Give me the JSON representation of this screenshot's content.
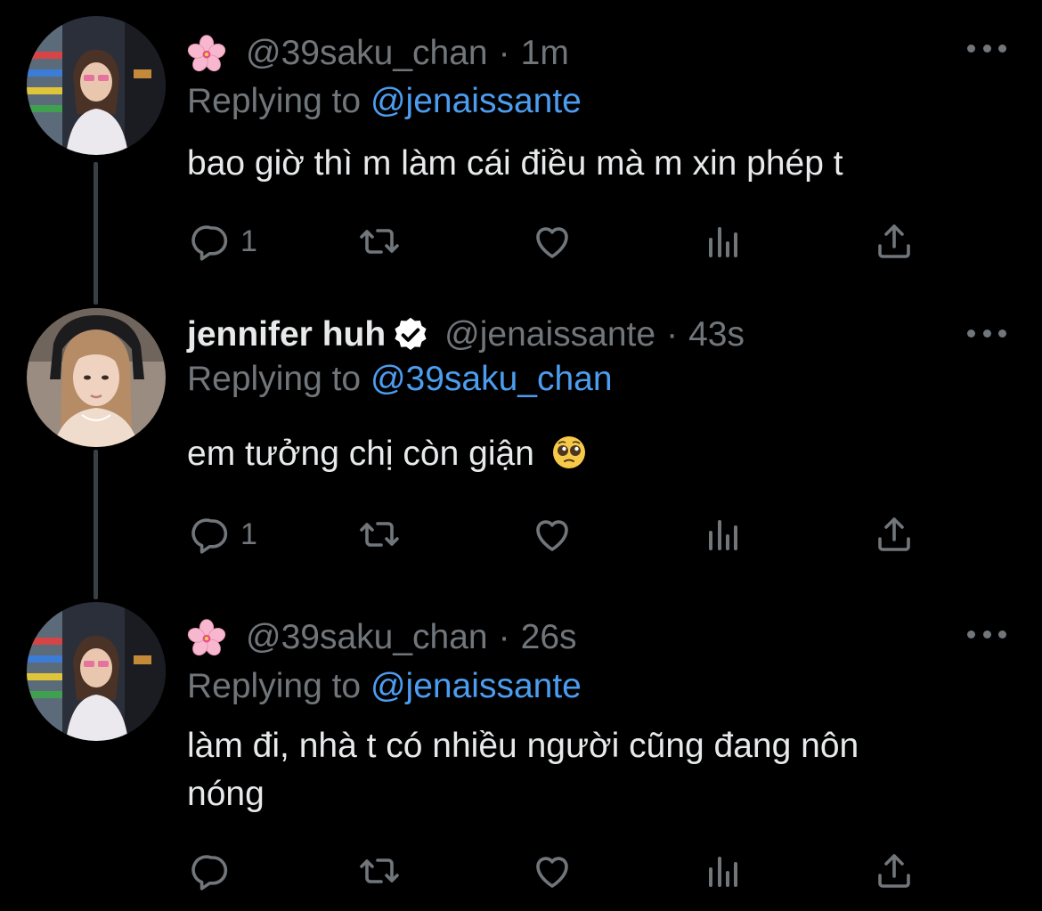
{
  "tweets": [
    {
      "display_name": "",
      "handle": "@39saku_chan",
      "time": "1m",
      "replying_label": "Replying to ",
      "replying_to": "@jenaissante",
      "text": "bao giờ thì m làm cái điều mà m xin phép t",
      "reply_count": "1",
      "verified": false,
      "name_emoji": "cherry-blossom"
    },
    {
      "display_name": "jennifer huh",
      "handle": "@jenaissante",
      "time": "43s",
      "replying_label": "Replying to ",
      "replying_to": "@39saku_chan",
      "text": "em tưởng chị còn giận",
      "text_emoji": "pleading-face",
      "reply_count": "1",
      "verified": true
    },
    {
      "display_name": "",
      "handle": "@39saku_chan",
      "time": "26s",
      "replying_label": "Replying to ",
      "replying_to": "@jenaissante",
      "text_line1": "làm đi, nhà t có nhiều người cũng đang nôn",
      "text_line2": "nóng",
      "reply_count": "",
      "verified": false,
      "name_emoji": "cherry-blossom"
    }
  ],
  "separator": "·",
  "icons": [
    "reply-icon",
    "retweet-icon",
    "like-icon",
    "analytics-icon",
    "share-icon",
    "more-icon",
    "verified-icon"
  ],
  "colors": {
    "background": "#000000",
    "text": "#e7e9ea",
    "muted": "#71767b",
    "link": "#4c9df0"
  }
}
